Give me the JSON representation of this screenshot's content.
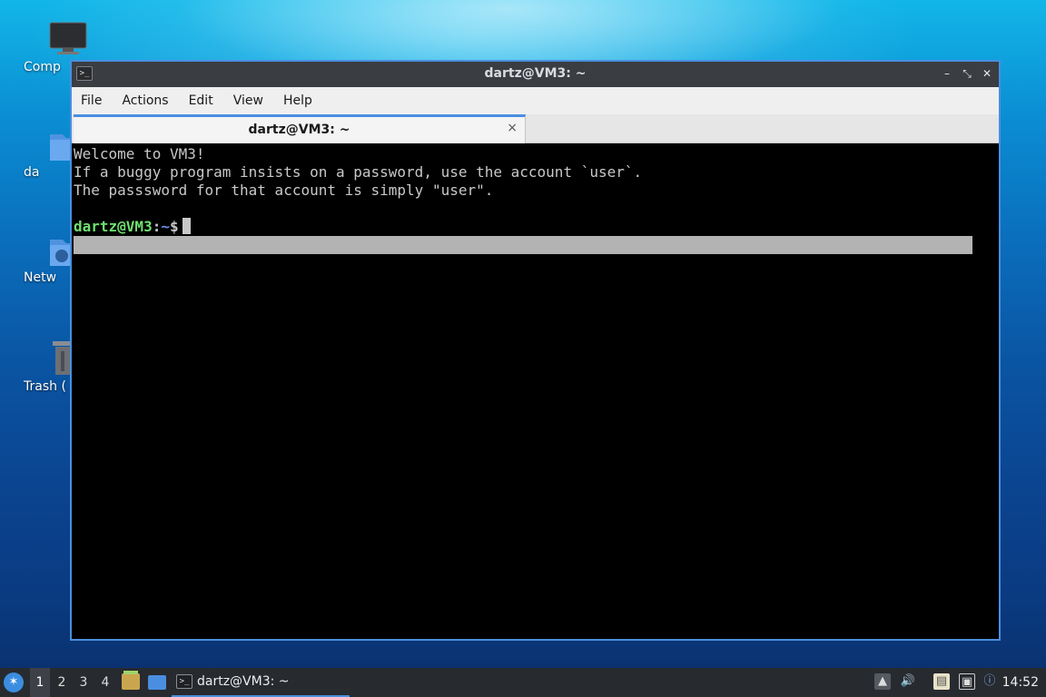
{
  "desktop": {
    "icons": [
      {
        "label": "Comp",
        "icon": "computer-icon"
      },
      {
        "label": "da",
        "icon": "home-folder-icon"
      },
      {
        "label": "Netw",
        "icon": "network-folder-icon"
      },
      {
        "label": "Trash (",
        "icon": "trash-icon"
      }
    ]
  },
  "window": {
    "title": "dartz@VM3: ~",
    "controls": {
      "minimize": "–",
      "maximize": "⤡",
      "close": "✕"
    },
    "menu": [
      "File",
      "Actions",
      "Edit",
      "View",
      "Help"
    ],
    "tab": {
      "title": "dartz@VM3: ~",
      "close": "×"
    },
    "terminal": {
      "lines": [
        "Welcome to VM3!",
        "If a buggy program insists on a password, use the account `user`.",
        "The passsword for that account is simply \"user\"."
      ],
      "prompt": {
        "user_host": "dartz@VM3",
        "sep": ":",
        "path": "~",
        "symbol": "$"
      }
    }
  },
  "taskbar": {
    "workspaces": [
      "1",
      "2",
      "3",
      "4"
    ],
    "active_workspace": "1",
    "task_label": "dartz@VM3: ~",
    "clock": "14:52"
  },
  "colors": {
    "accent": "#4a8ee0",
    "prompt_user": "#6fe06f",
    "prompt_path": "#6a8fe8",
    "terminal_bg": "#000000"
  }
}
